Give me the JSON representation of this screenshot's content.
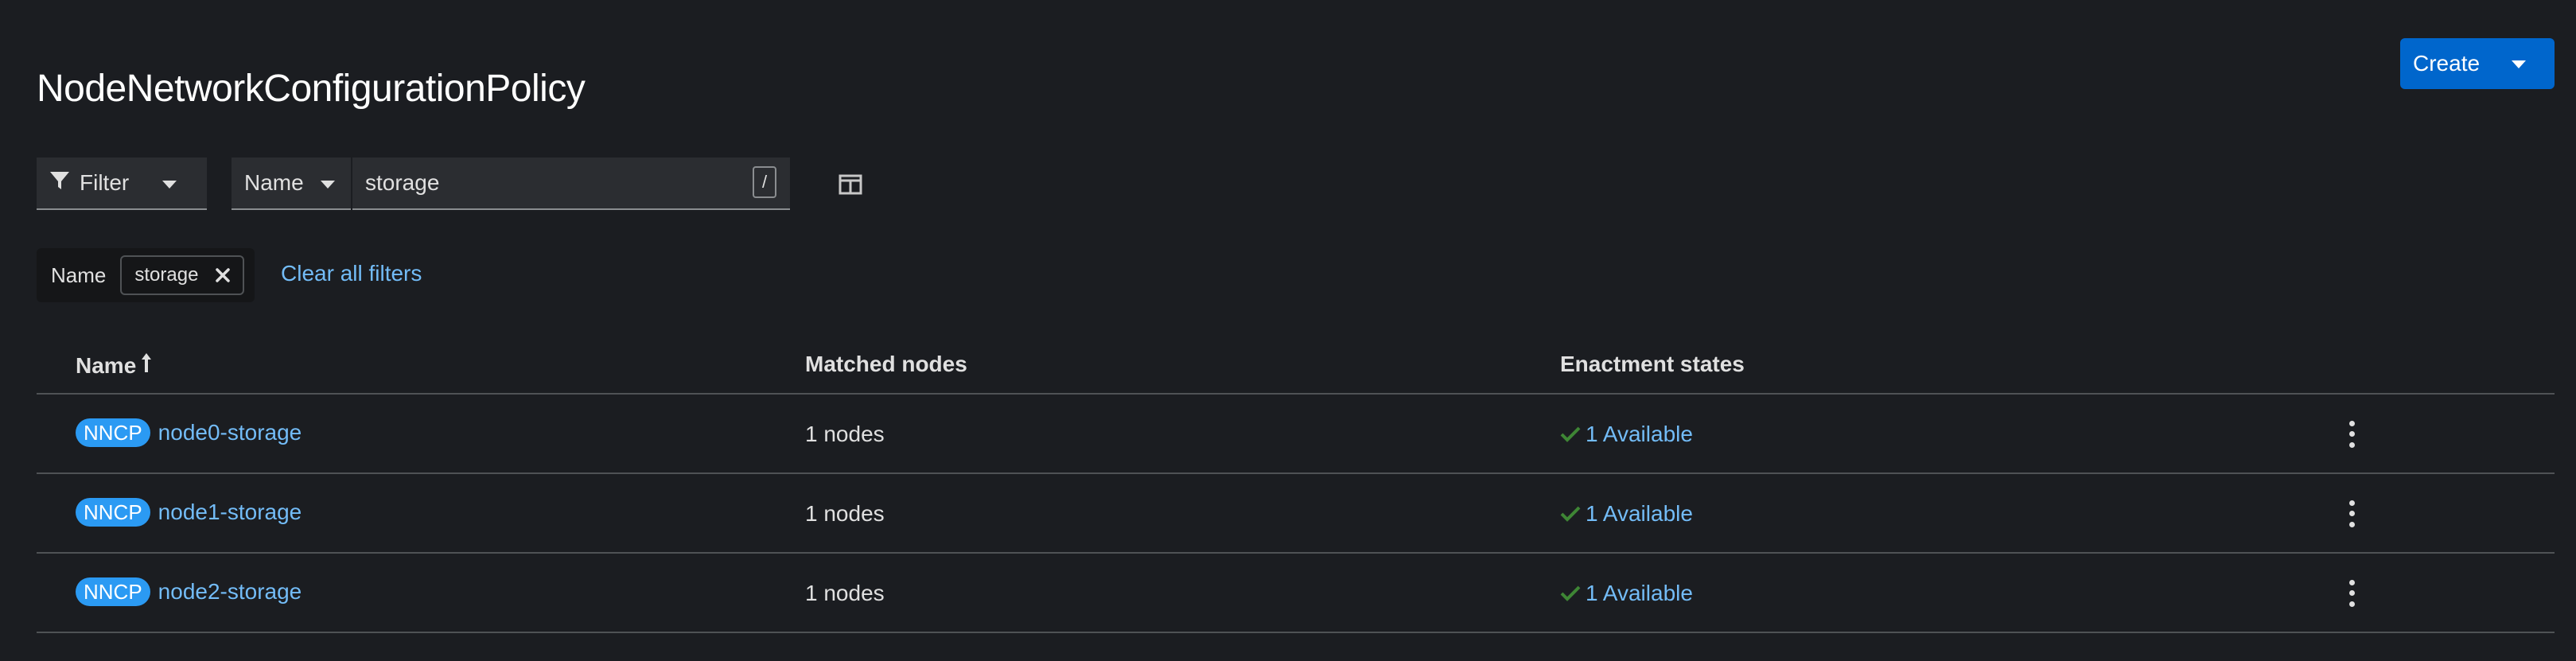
{
  "page": {
    "title": "NodeNetworkConfigurationPolicy"
  },
  "header": {
    "create_label": "Create"
  },
  "toolbar": {
    "filter_label": "Filter",
    "attribute_select": "Name",
    "search_value": "storage",
    "kbd_hint": "/"
  },
  "chips": {
    "category": "Name",
    "value": "storage",
    "clear_all": "Clear all filters"
  },
  "table": {
    "columns": [
      "Name",
      "Matched nodes",
      "Enactment states"
    ],
    "rows": [
      {
        "badge": "NNCP",
        "name": "node0-storage",
        "matched": "1 nodes",
        "state": "1 Available"
      },
      {
        "badge": "NNCP",
        "name": "node1-storage",
        "matched": "1 nodes",
        "state": "1 Available"
      },
      {
        "badge": "NNCP",
        "name": "node2-storage",
        "matched": "1 nodes",
        "state": "1 Available"
      }
    ]
  },
  "icons": {
    "filter": "filter-icon",
    "columns": "columns-icon",
    "sort": "sort-ascending-icon",
    "check": "check-icon",
    "kebab": "kebab-icon",
    "close": "close-icon"
  },
  "colors": {
    "primary": "#0066cc",
    "link": "#73bcf7",
    "badge": "#2b9af3",
    "success": "#3e8635",
    "background": "#1b1d21"
  }
}
